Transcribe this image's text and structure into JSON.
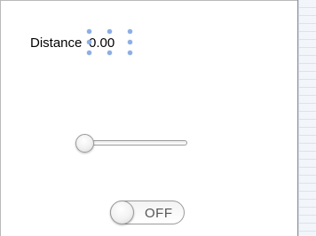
{
  "distance": {
    "label": "Distance",
    "value": "0.00"
  },
  "slider": {
    "value_fraction": 0.0
  },
  "toggle": {
    "label": "OFF",
    "state": "off"
  },
  "colors": {
    "selection_handle": "#8aaee6",
    "divider": "#8e8e8e"
  }
}
